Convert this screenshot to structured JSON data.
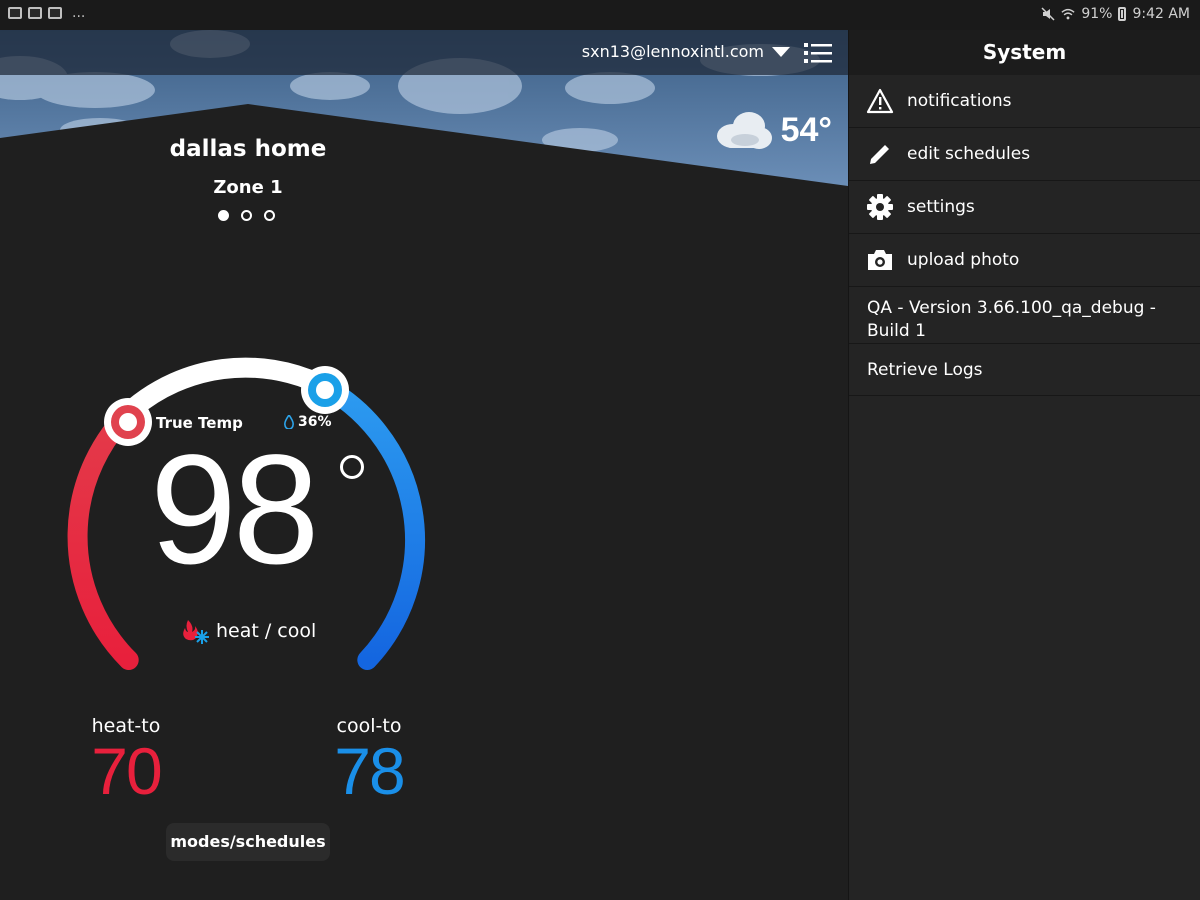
{
  "statusbar": {
    "battery": "91%",
    "time": "9:42 AM",
    "overflow": "..."
  },
  "header": {
    "account": "sxn13@lennoxintl.com"
  },
  "weather": {
    "outdoor_temp": "54°"
  },
  "location": {
    "home": "dallas home",
    "zone": "Zone 1",
    "pages": 3,
    "active_page": 0
  },
  "thermostat": {
    "true_temp_label": "True Temp",
    "humidity": "36%",
    "temperature": "98",
    "mode": "heat / cool",
    "heat_label": "heat-to",
    "heat_value": "70",
    "cool_label": "cool-to",
    "cool_value": "78",
    "heat_color": "#e8203c",
    "cool_color": "#1a8fe8"
  },
  "footer": {
    "modes_button": "modes/schedules"
  },
  "side": {
    "title": "System",
    "items": [
      {
        "label": "notifications",
        "icon": "warning-icon"
      },
      {
        "label": "edit schedules",
        "icon": "pencil-icon"
      },
      {
        "label": "settings",
        "icon": "gear-icon"
      },
      {
        "label": "upload photo",
        "icon": "camera-icon"
      }
    ],
    "version": "QA - Version 3.66.100_qa_debug - Build 1",
    "logs": "Retrieve Logs"
  }
}
